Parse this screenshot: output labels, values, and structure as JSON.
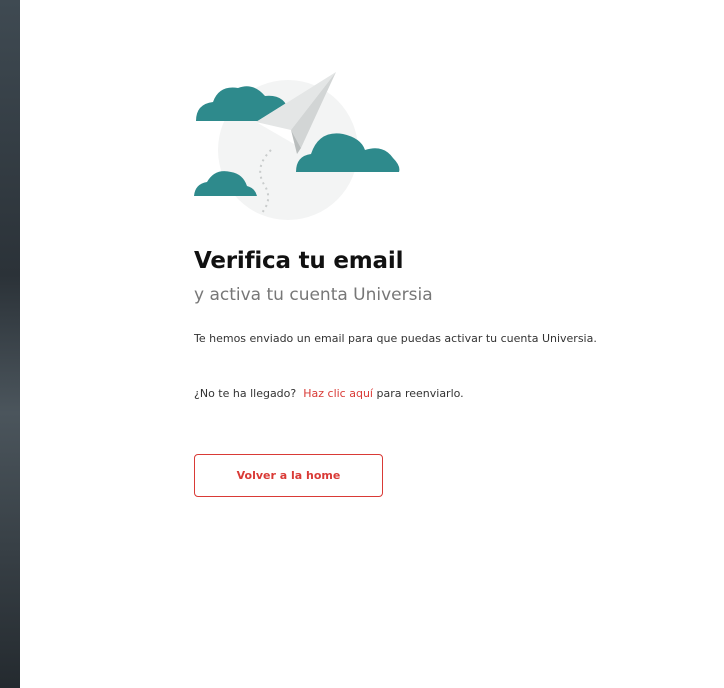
{
  "colors": {
    "accent": "#d93a36",
    "cloud": "#2e8a8c"
  },
  "icons": {
    "illustration": "paper-plane-clouds-icon"
  },
  "verify": {
    "title": "Verifica tu email",
    "subtitle": "y activa tu cuenta Universia",
    "message": "Te hemos enviado un email para que puedas activar tu cuenta Universia.",
    "resend_prefix": "¿No te ha llegado?",
    "resend_link": "Haz clic aquí",
    "resend_suffix": "para reenviarlo.",
    "home_button": "Volver a la home"
  }
}
